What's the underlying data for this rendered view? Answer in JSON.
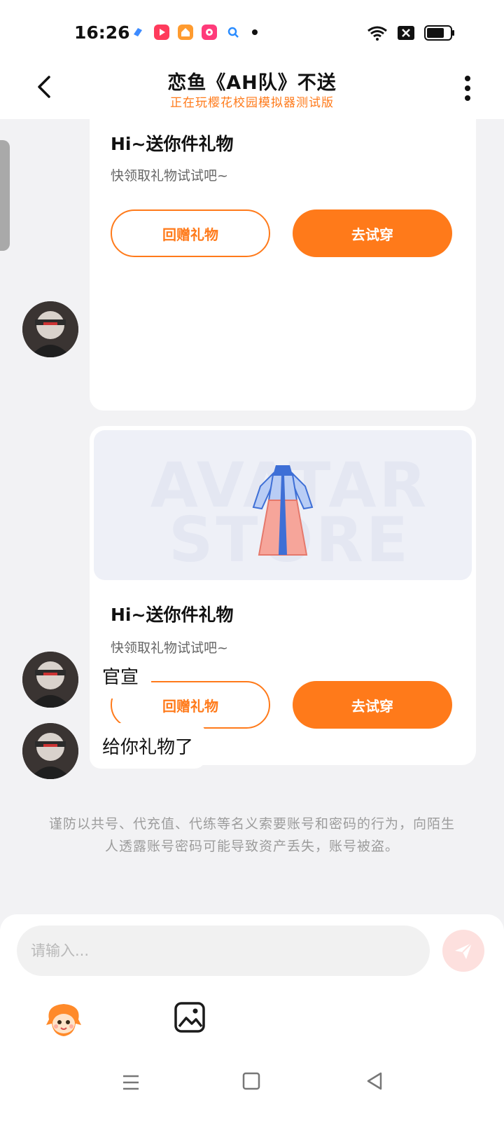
{
  "status_bar": {
    "time": "16:26"
  },
  "header": {
    "title": "恋鱼《AH队》不送",
    "subtitle": "正在玩樱花校园模拟器测试版"
  },
  "messages": {
    "gift_card_1": {
      "title": "Hi~送你件礼物",
      "subtitle": "快领取礼物试试吧~",
      "return_gift_label": "回赠礼物",
      "try_on_label": "去试穿"
    },
    "gift_card_2": {
      "watermark_line1": "AVATAR",
      "watermark_line2": "STORE",
      "title": "Hi~送你件礼物",
      "subtitle": "快领取礼物试试吧~",
      "return_gift_label": "回赠礼物",
      "try_on_label": "去试穿"
    },
    "text_1": "官宣",
    "text_2": "给你礼物了"
  },
  "notice": "谨防以共号、代充值、代练等名义索要账号和密码的行为，向陌生人透露账号密码可能导致资产丢失，账号被盗。",
  "composer": {
    "placeholder": "请输入...",
    "value": ""
  },
  "colors": {
    "accent": "#ff7a1a",
    "background": "#f2f2f4",
    "send_disabled": "#fde0de"
  },
  "icons": {
    "back": "chevron-left-icon",
    "more": "more-vertical-icon",
    "send": "send-icon",
    "sticker": "sticker-icon",
    "image": "image-icon",
    "nav_menu": "menu-icon",
    "nav_home": "home-square-icon",
    "nav_back": "back-triangle-icon"
  }
}
